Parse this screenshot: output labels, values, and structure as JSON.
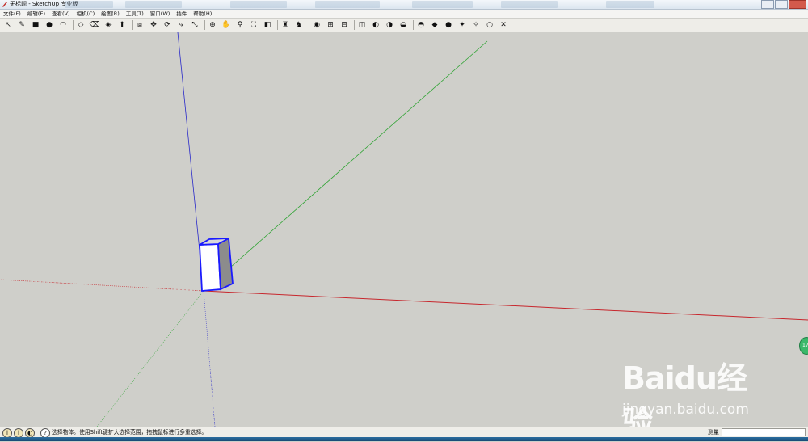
{
  "window": {
    "title": "无标题 - SketchUp 专业版"
  },
  "menubar": {
    "items": [
      {
        "label": "文件(F)"
      },
      {
        "label": "编辑(E)"
      },
      {
        "label": "查看(V)"
      },
      {
        "label": "相机(C)"
      },
      {
        "label": "绘图(R)"
      },
      {
        "label": "工具(T)"
      },
      {
        "label": "窗口(W)"
      },
      {
        "label": "插件"
      },
      {
        "label": "帮助(H)"
      }
    ]
  },
  "toolbar": {
    "tools": [
      {
        "icon": "select-arrow-icon",
        "glyph": "↖"
      },
      {
        "icon": "pencil-line-icon",
        "glyph": "✎"
      },
      {
        "icon": "rectangle-icon",
        "glyph": "■"
      },
      {
        "icon": "circle-icon",
        "glyph": "●"
      },
      {
        "icon": "arc-icon",
        "glyph": "◠"
      },
      {
        "icon": "make-component-icon",
        "glyph": "◇"
      },
      {
        "icon": "eraser-icon",
        "glyph": "⌫"
      },
      {
        "icon": "paint-bucket-icon",
        "glyph": "◈"
      },
      {
        "icon": "push-pull-icon",
        "glyph": "⬆"
      },
      {
        "icon": "offset-icon",
        "glyph": "⧈"
      },
      {
        "icon": "move-icon",
        "glyph": "✥"
      },
      {
        "icon": "rotate-icon",
        "glyph": "⟳"
      },
      {
        "icon": "follow-me-icon",
        "glyph": "⤷"
      },
      {
        "icon": "scale-icon",
        "glyph": "⤡"
      },
      {
        "icon": "orbit-icon",
        "glyph": "⊕"
      },
      {
        "icon": "pan-hand-icon",
        "glyph": "✋"
      },
      {
        "icon": "zoom-icon",
        "glyph": "⚲"
      },
      {
        "icon": "zoom-extents-icon",
        "glyph": "⛶"
      },
      {
        "icon": "previous-view-icon",
        "glyph": "◧"
      },
      {
        "icon": "position-camera-icon",
        "glyph": "♜"
      },
      {
        "icon": "walk-icon",
        "glyph": "♞"
      },
      {
        "icon": "look-around-icon",
        "glyph": "◉"
      },
      {
        "icon": "tape-measure-icon",
        "glyph": "⊞"
      },
      {
        "icon": "dimension-icon",
        "glyph": "⊟"
      },
      {
        "icon": "section-plane-icon",
        "glyph": "◫"
      },
      {
        "icon": "google-earth-icon",
        "glyph": "◐"
      },
      {
        "icon": "get-models-icon",
        "glyph": "◑"
      },
      {
        "icon": "share-model-icon",
        "glyph": "◒"
      },
      {
        "icon": "photo-texture-icon",
        "glyph": "◓"
      },
      {
        "icon": "sandbox-icon",
        "glyph": "◆"
      },
      {
        "icon": "sun-icon",
        "glyph": "●"
      },
      {
        "icon": "shadow-icon",
        "glyph": "✦"
      },
      {
        "icon": "fog-icon",
        "glyph": "✧"
      },
      {
        "icon": "hidden-line-icon",
        "glyph": "○"
      },
      {
        "icon": "axes-icon",
        "glyph": "✕"
      }
    ]
  },
  "status": {
    "hint": "选择物体。使用Shift键扩大选择范围，拖拽鼠标进行多重选择。",
    "measure_label": "测量",
    "measure_value": ""
  },
  "colors": {
    "viewport_bg": "#cfcfca",
    "red_axis": "#c7272d",
    "green_axis": "#2ea332",
    "blue_axis": "#2a2ac9",
    "selection": "#1a1aff"
  },
  "watermark": {
    "logo": "Baidu经验",
    "sub": "jingyan.baidu.com"
  }
}
